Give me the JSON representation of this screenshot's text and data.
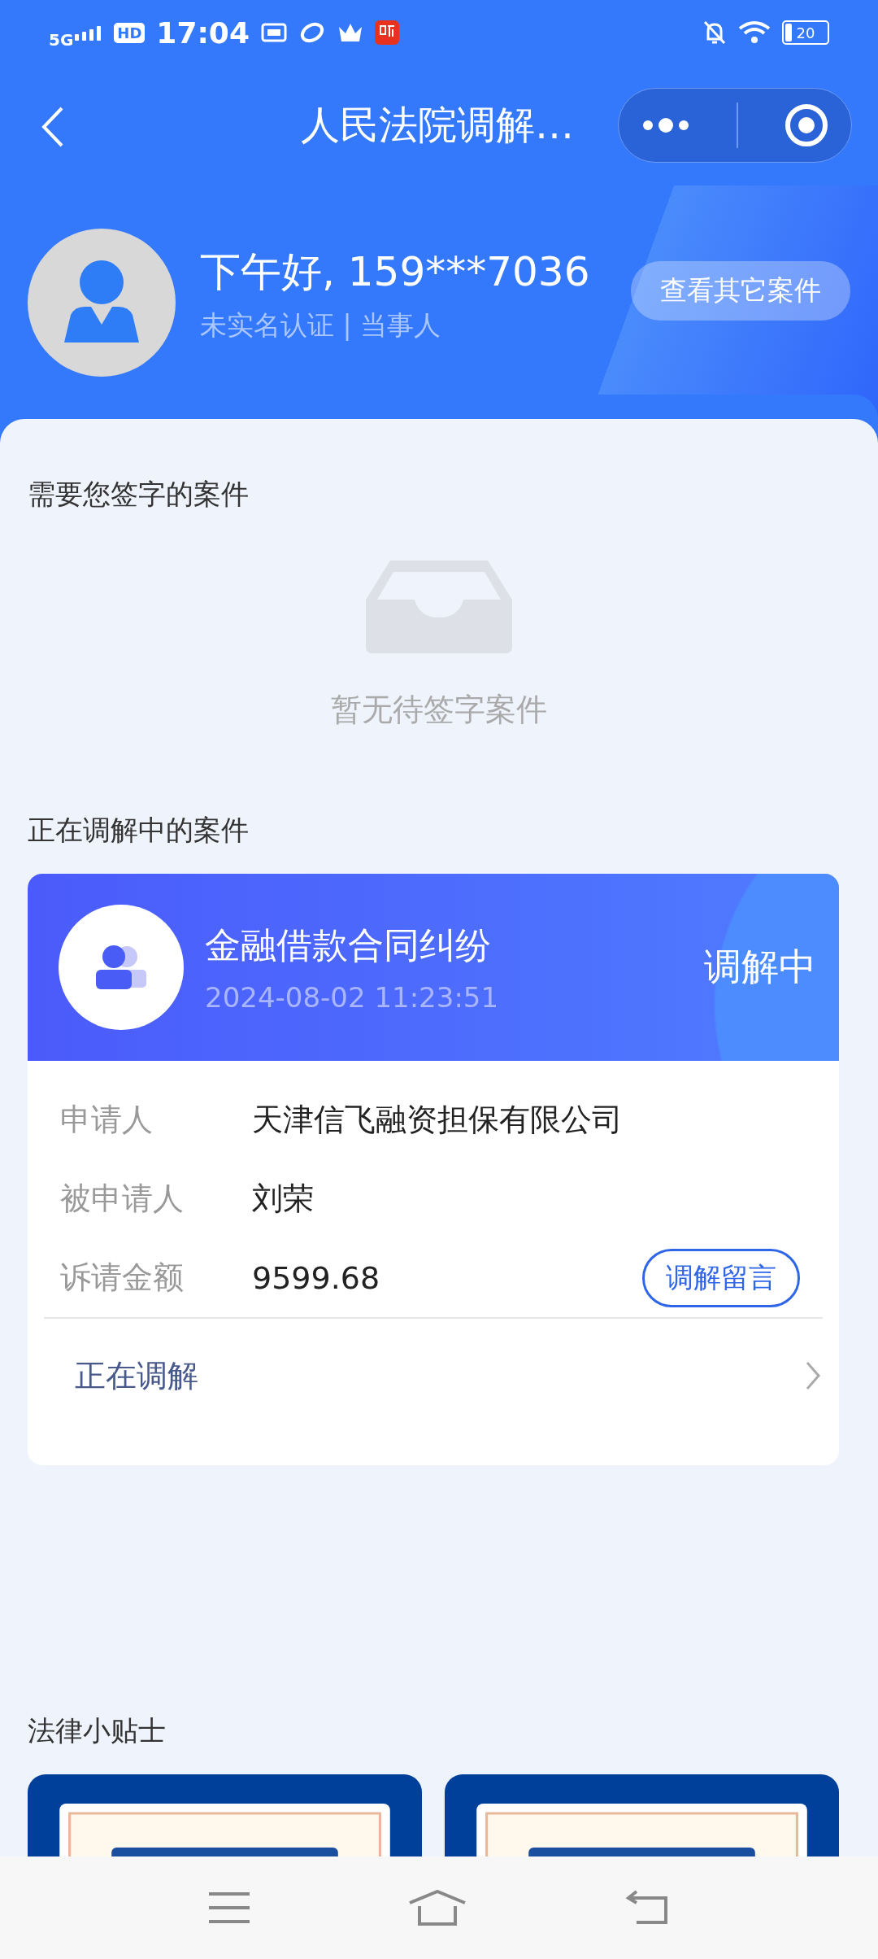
{
  "status_bar": {
    "network": "5G",
    "hd": "HD",
    "time": "17:04",
    "battery": "20"
  },
  "nav": {
    "title": "人民法院调解…"
  },
  "profile": {
    "greeting": "下午好, 159***7036",
    "subtitle": "未实名认证 | 当事人",
    "button": "查看其它案件"
  },
  "pending": {
    "title": "需要您签字的案件",
    "empty_text": "暂无待签字案件"
  },
  "mediating": {
    "title": "正在调解中的案件",
    "cases": [
      {
        "title": "金融借款合同纠纷",
        "time": "2024-08-02 11:23:51",
        "status": "调解中",
        "fields": [
          {
            "label": "申请人",
            "value": "天津信飞融资担保有限公司"
          },
          {
            "label": "被申请人",
            "value": "刘荣"
          },
          {
            "label": "诉请金额",
            "value": "9599.68",
            "action": "调解留言"
          }
        ],
        "footer": "正在调解"
      }
    ]
  },
  "tips": {
    "title": "法律小贴士"
  }
}
